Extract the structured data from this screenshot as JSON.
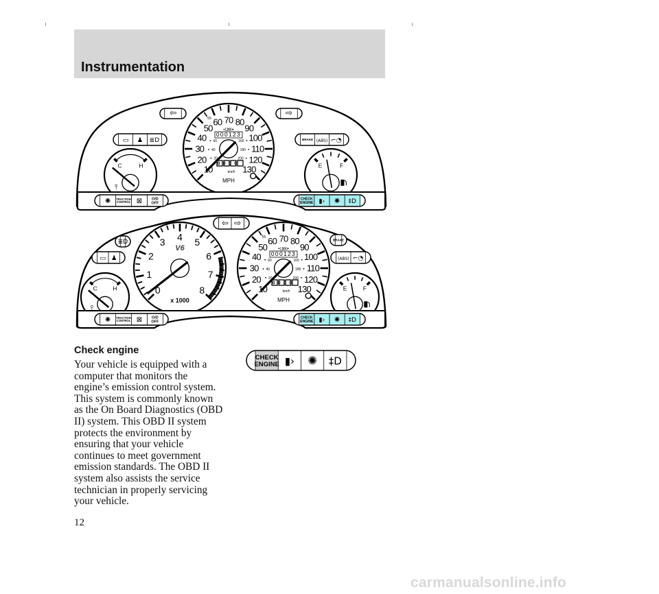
{
  "header": {
    "title": "Instrumentation"
  },
  "cluster_common": {
    "speedo_mph": [
      "10",
      "20",
      "30",
      "40",
      "50",
      "60",
      "70",
      "80",
      "90",
      "100",
      "110",
      "120",
      "130"
    ],
    "speedo_kmh": [
      "20",
      "40",
      "60",
      "80",
      "100",
      "120",
      "140",
      "160",
      "180",
      "200"
    ],
    "speedo_55": "55",
    "odometer": "000123",
    "trip": "0000",
    "kmh_label": "km/h",
    "mph_label": "MPH",
    "temp_cold": "C",
    "temp_hot": "H",
    "fuel_empty": "E",
    "fuel_full": "F",
    "tach_labels": [
      "0",
      "1",
      "2",
      "3",
      "4",
      "5",
      "6",
      "7",
      "8"
    ],
    "tach_unit": "x 1000",
    "engine_badge": "V6",
    "brake_label": "BRAKE",
    "abs_label": "(ABS)",
    "traction_label": "TRACTION CONTROL",
    "od_label": "O/D OFF",
    "check_engine_label": "CHECK ENGINE",
    "warning_colors": {
      "lit": "#a9eef0",
      "highlight": "#cfcfcf"
    },
    "icons": [
      "battery-icon",
      "seatbelt-icon",
      "headlamp-icon",
      "brake-icon",
      "abs-icon",
      "oil-pressure-icon",
      "coolant-temp-icon",
      "fuel-pump-icon",
      "airbag-icon",
      "fog-lamp-icon",
      "transmission-icon",
      "turn-left-icon",
      "turn-right-icon"
    ]
  },
  "section": {
    "heading": "Check engine",
    "lines": [
      "Your vehicle is equipped with a",
      "computer that monitors the",
      "engine’s emission control system.",
      "This system is commonly known",
      "as the On Board Diagnostics (OBD",
      "II) system. This OBD II system",
      "protects the environment by",
      "ensuring that your vehicle",
      "continues to meet government",
      "emission standards. The OBD II",
      "system also assists the service",
      "technician in properly servicing",
      "your vehicle."
    ]
  },
  "page_number": "12",
  "watermark": "carmanualsonline.info"
}
